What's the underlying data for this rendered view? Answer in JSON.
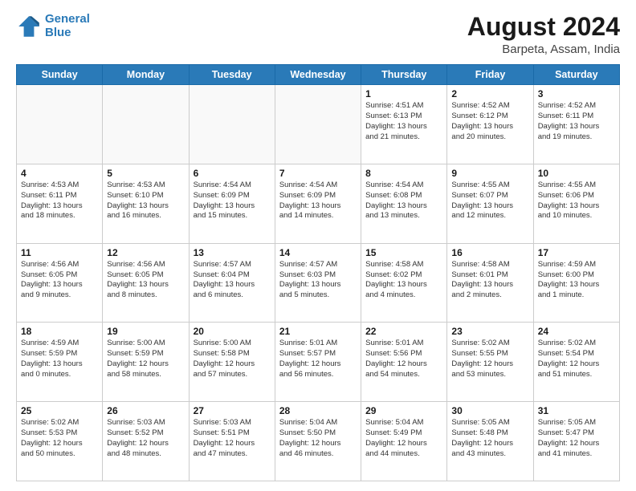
{
  "header": {
    "logo_line1": "General",
    "logo_line2": "Blue",
    "title": "August 2024",
    "subtitle": "Barpeta, Assam, India"
  },
  "days_of_week": [
    "Sunday",
    "Monday",
    "Tuesday",
    "Wednesday",
    "Thursday",
    "Friday",
    "Saturday"
  ],
  "weeks": [
    [
      {
        "day": "",
        "info": ""
      },
      {
        "day": "",
        "info": ""
      },
      {
        "day": "",
        "info": ""
      },
      {
        "day": "",
        "info": ""
      },
      {
        "day": "1",
        "info": "Sunrise: 4:51 AM\nSunset: 6:13 PM\nDaylight: 13 hours\nand 21 minutes."
      },
      {
        "day": "2",
        "info": "Sunrise: 4:52 AM\nSunset: 6:12 PM\nDaylight: 13 hours\nand 20 minutes."
      },
      {
        "day": "3",
        "info": "Sunrise: 4:52 AM\nSunset: 6:11 PM\nDaylight: 13 hours\nand 19 minutes."
      }
    ],
    [
      {
        "day": "4",
        "info": "Sunrise: 4:53 AM\nSunset: 6:11 PM\nDaylight: 13 hours\nand 18 minutes."
      },
      {
        "day": "5",
        "info": "Sunrise: 4:53 AM\nSunset: 6:10 PM\nDaylight: 13 hours\nand 16 minutes."
      },
      {
        "day": "6",
        "info": "Sunrise: 4:54 AM\nSunset: 6:09 PM\nDaylight: 13 hours\nand 15 minutes."
      },
      {
        "day": "7",
        "info": "Sunrise: 4:54 AM\nSunset: 6:09 PM\nDaylight: 13 hours\nand 14 minutes."
      },
      {
        "day": "8",
        "info": "Sunrise: 4:54 AM\nSunset: 6:08 PM\nDaylight: 13 hours\nand 13 minutes."
      },
      {
        "day": "9",
        "info": "Sunrise: 4:55 AM\nSunset: 6:07 PM\nDaylight: 13 hours\nand 12 minutes."
      },
      {
        "day": "10",
        "info": "Sunrise: 4:55 AM\nSunset: 6:06 PM\nDaylight: 13 hours\nand 10 minutes."
      }
    ],
    [
      {
        "day": "11",
        "info": "Sunrise: 4:56 AM\nSunset: 6:05 PM\nDaylight: 13 hours\nand 9 minutes."
      },
      {
        "day": "12",
        "info": "Sunrise: 4:56 AM\nSunset: 6:05 PM\nDaylight: 13 hours\nand 8 minutes."
      },
      {
        "day": "13",
        "info": "Sunrise: 4:57 AM\nSunset: 6:04 PM\nDaylight: 13 hours\nand 6 minutes."
      },
      {
        "day": "14",
        "info": "Sunrise: 4:57 AM\nSunset: 6:03 PM\nDaylight: 13 hours\nand 5 minutes."
      },
      {
        "day": "15",
        "info": "Sunrise: 4:58 AM\nSunset: 6:02 PM\nDaylight: 13 hours\nand 4 minutes."
      },
      {
        "day": "16",
        "info": "Sunrise: 4:58 AM\nSunset: 6:01 PM\nDaylight: 13 hours\nand 2 minutes."
      },
      {
        "day": "17",
        "info": "Sunrise: 4:59 AM\nSunset: 6:00 PM\nDaylight: 13 hours\nand 1 minute."
      }
    ],
    [
      {
        "day": "18",
        "info": "Sunrise: 4:59 AM\nSunset: 5:59 PM\nDaylight: 13 hours\nand 0 minutes."
      },
      {
        "day": "19",
        "info": "Sunrise: 5:00 AM\nSunset: 5:59 PM\nDaylight: 12 hours\nand 58 minutes."
      },
      {
        "day": "20",
        "info": "Sunrise: 5:00 AM\nSunset: 5:58 PM\nDaylight: 12 hours\nand 57 minutes."
      },
      {
        "day": "21",
        "info": "Sunrise: 5:01 AM\nSunset: 5:57 PM\nDaylight: 12 hours\nand 56 minutes."
      },
      {
        "day": "22",
        "info": "Sunrise: 5:01 AM\nSunset: 5:56 PM\nDaylight: 12 hours\nand 54 minutes."
      },
      {
        "day": "23",
        "info": "Sunrise: 5:02 AM\nSunset: 5:55 PM\nDaylight: 12 hours\nand 53 minutes."
      },
      {
        "day": "24",
        "info": "Sunrise: 5:02 AM\nSunset: 5:54 PM\nDaylight: 12 hours\nand 51 minutes."
      }
    ],
    [
      {
        "day": "25",
        "info": "Sunrise: 5:02 AM\nSunset: 5:53 PM\nDaylight: 12 hours\nand 50 minutes."
      },
      {
        "day": "26",
        "info": "Sunrise: 5:03 AM\nSunset: 5:52 PM\nDaylight: 12 hours\nand 48 minutes."
      },
      {
        "day": "27",
        "info": "Sunrise: 5:03 AM\nSunset: 5:51 PM\nDaylight: 12 hours\nand 47 minutes."
      },
      {
        "day": "28",
        "info": "Sunrise: 5:04 AM\nSunset: 5:50 PM\nDaylight: 12 hours\nand 46 minutes."
      },
      {
        "day": "29",
        "info": "Sunrise: 5:04 AM\nSunset: 5:49 PM\nDaylight: 12 hours\nand 44 minutes."
      },
      {
        "day": "30",
        "info": "Sunrise: 5:05 AM\nSunset: 5:48 PM\nDaylight: 12 hours\nand 43 minutes."
      },
      {
        "day": "31",
        "info": "Sunrise: 5:05 AM\nSunset: 5:47 PM\nDaylight: 12 hours\nand 41 minutes."
      }
    ]
  ]
}
